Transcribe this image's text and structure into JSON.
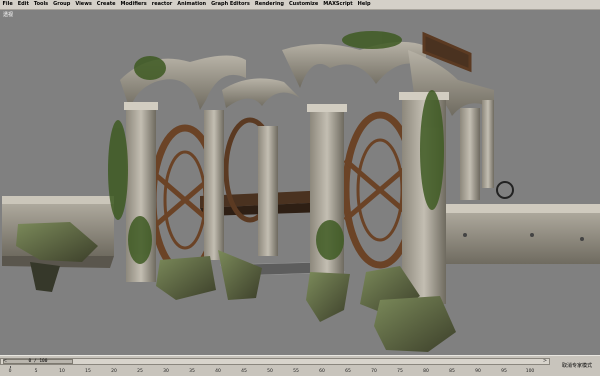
{
  "menubar": {
    "items": [
      "File",
      "Edit",
      "Tools",
      "Group",
      "Views",
      "Create",
      "Modifiers",
      "reactor",
      "Animation",
      "Graph Editors",
      "Rendering",
      "Customize",
      "MAXScript",
      "Help"
    ]
  },
  "viewport": {
    "label": "透视"
  },
  "timeline": {
    "frame_display": "0 / 100",
    "prev_arrow": "<",
    "next_arrow": ">",
    "ticks": [
      "0",
      "5",
      "10",
      "15",
      "20",
      "25",
      "30",
      "35",
      "40",
      "45",
      "50",
      "55",
      "60",
      "65",
      "70",
      "75",
      "80",
      "85",
      "90",
      "95",
      "100"
    ]
  },
  "status": {
    "mode_text": "取消专家模式"
  },
  "colors": {
    "viewport_bg": "#808080",
    "chrome": "#d4d0c8",
    "stone": "#9b9689",
    "wood": "#6b4326",
    "moss": "#3e5a22"
  }
}
